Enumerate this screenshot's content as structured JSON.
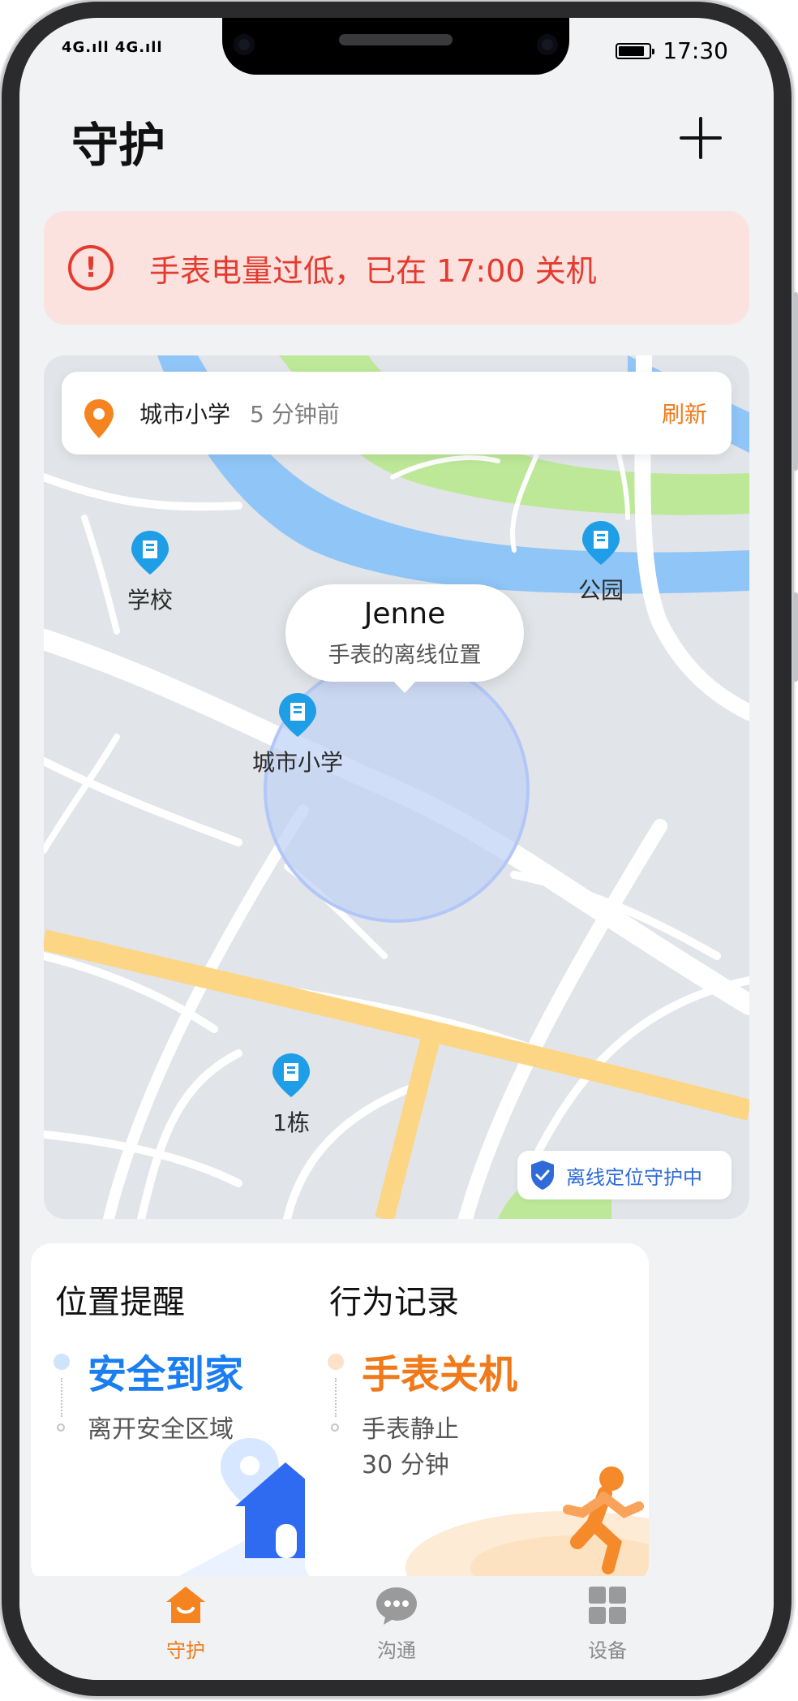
{
  "status_bar": {
    "signal": "4G.ıll 4G.ıll",
    "time": "17:30"
  },
  "header": {
    "title": "守护"
  },
  "alert": {
    "icon": "exclamation-icon",
    "text": "手表电量过低，已在 17:00 关机",
    "color": "#e53a2e"
  },
  "map": {
    "location_name": "城市小学",
    "updated_ago": "5 分钟前",
    "refresh_label": "刷新",
    "pois": [
      {
        "label": "学校",
        "icon": "building-icon"
      },
      {
        "label": "公园",
        "icon": "building-icon"
      },
      {
        "label": "城市小学",
        "icon": "building-icon"
      },
      {
        "label": "1栋",
        "icon": "building-icon"
      }
    ],
    "bubble": {
      "name": "Jenne",
      "subtitle": "手表的离线位置"
    },
    "guard_badge": "离线定位守护中"
  },
  "location_card": {
    "title": "位置提醒",
    "current": "安全到家",
    "previous": "离开安全区域",
    "accent": "#1a7ef0"
  },
  "behavior_card": {
    "title": "行为记录",
    "current": "手表关机",
    "previous_line1": "手表静止",
    "previous_line2": "30 分钟",
    "accent": "#f07a1a"
  },
  "tabbar": {
    "items": [
      {
        "label": "守护",
        "icon": "home-icon",
        "active": true
      },
      {
        "label": "沟通",
        "icon": "chat-icon",
        "active": false
      },
      {
        "label": "设备",
        "icon": "grid-icon",
        "active": false
      }
    ],
    "active_color": "#f07a1a",
    "inactive_color": "#8a8a8a"
  }
}
